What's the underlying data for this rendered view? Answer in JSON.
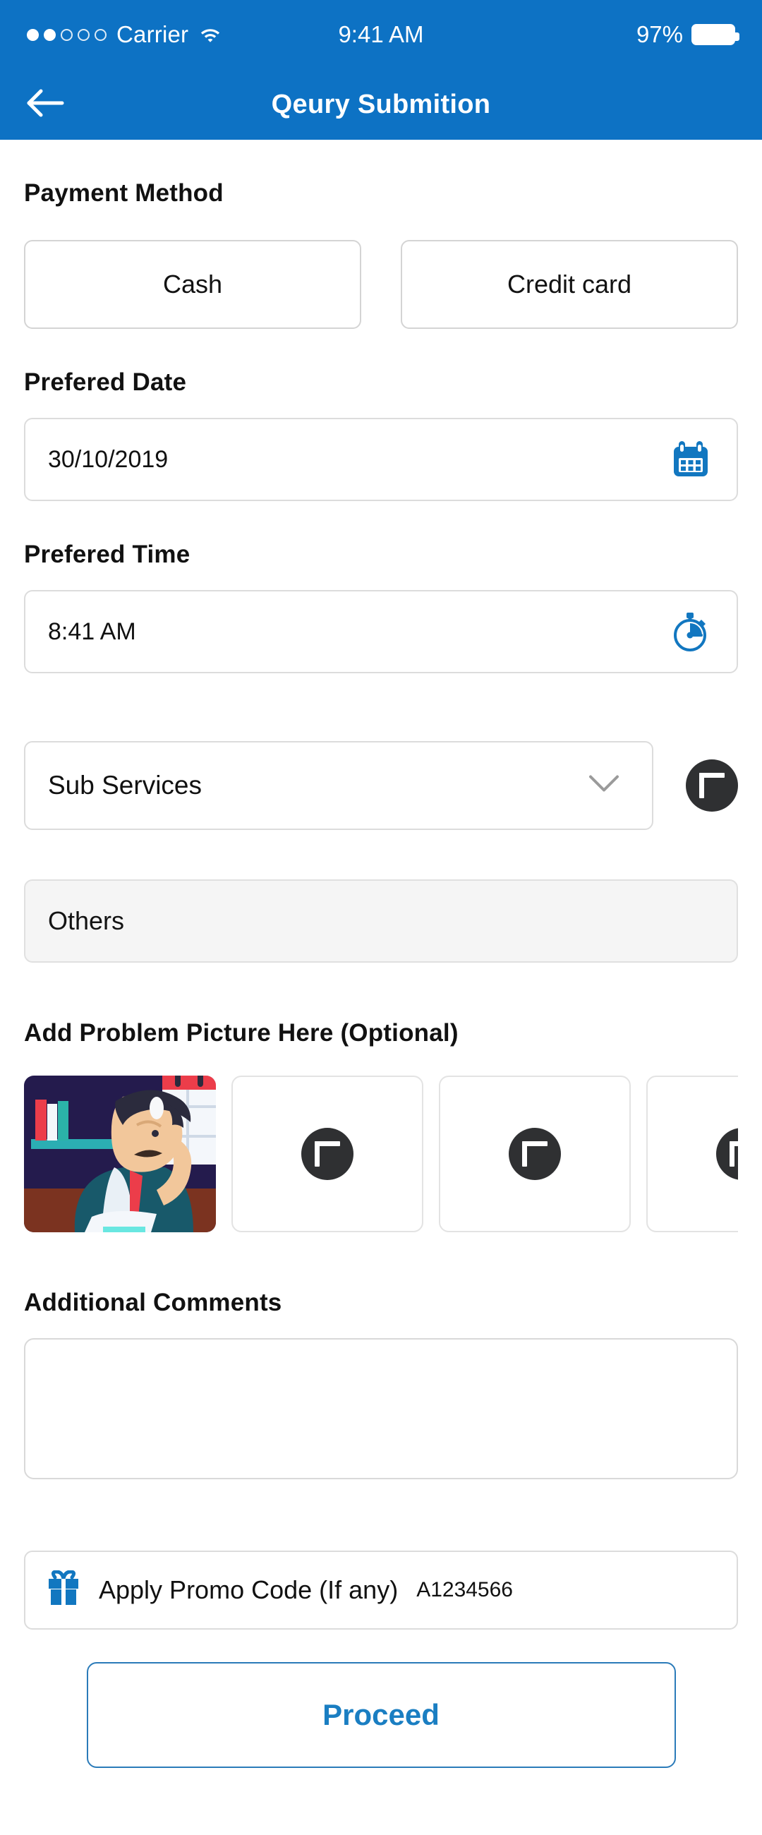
{
  "theme": {
    "header_blue": "#0d72c4",
    "accent_blue": "#1a7ec2",
    "icon_blue": "#1277c0",
    "dark_circle": "#2f3032"
  },
  "status_bar": {
    "carrier": "Carrier",
    "signal_bars_filled": 2,
    "signal_bars_total": 5,
    "wifi": "wifi-icon",
    "time": "9:41 AM",
    "battery_percent": "97%"
  },
  "header": {
    "title": "Qeury Submition",
    "back": "back-arrow-icon"
  },
  "payment": {
    "label": "Payment Method",
    "options": [
      {
        "label": "Cash"
      },
      {
        "label": "Credit card"
      }
    ]
  },
  "preferred_date": {
    "label": "Prefered Date",
    "value": "30/10/2019",
    "icon": "calendar-icon"
  },
  "preferred_time": {
    "label": "Prefered Time",
    "value": "8:41 AM",
    "icon": "stopwatch-icon"
  },
  "sub_services": {
    "selected": "Sub Services",
    "chevron": "chevron-down-icon",
    "add_button": "plus-icon"
  },
  "others": {
    "value": "Others"
  },
  "problem_picture": {
    "label": "Add Problem Picture Here (Optional)",
    "thumbnail_alt": "stressed-businessman-illustration",
    "add_slots": 3,
    "add_icon": "plus-icon"
  },
  "additional_comments": {
    "label": "Additional Comments",
    "value": "",
    "placeholder": ""
  },
  "promo": {
    "icon": "gift-icon",
    "label": "Apply Promo Code (If any)",
    "code": "A1234566"
  },
  "proceed": {
    "label": "Proceed"
  }
}
